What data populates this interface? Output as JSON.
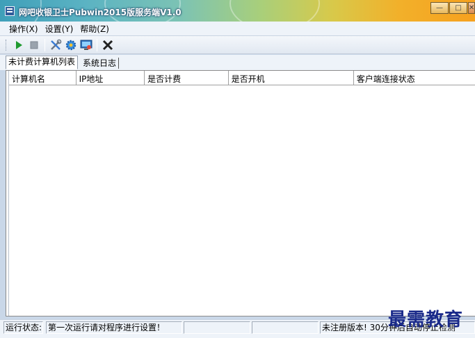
{
  "window": {
    "title": "网吧收银卫士Pubwin2015版服务端V1.0",
    "controls": {
      "minimize": "—",
      "maximize": "□",
      "close": "✕"
    }
  },
  "menu": {
    "items": [
      "操作(X)",
      "设置(Y)",
      "帮助(Z)"
    ]
  },
  "toolbar": {
    "buttons": [
      {
        "icon": "play-icon",
        "color": "#1f9a2f"
      },
      {
        "icon": "stop-icon",
        "color": "#9aa3ad"
      },
      {
        "icon": "tools-icon",
        "color": "#3a7bd5"
      },
      {
        "icon": "gear-icon",
        "color": "#3a8ee0"
      },
      {
        "icon": "monitor-icon",
        "color": "#2d6db8"
      },
      {
        "icon": "exit-icon",
        "color": "#222222"
      }
    ]
  },
  "tabs": [
    "未计费计算机列表",
    "系统日志"
  ],
  "table": {
    "columns": [
      "计算机名",
      "IP地址",
      "是否计费",
      "是否开机",
      "客户端连接状态"
    ],
    "rows": []
  },
  "statusbar": {
    "label": "运行状态:",
    "message": "第一次运行请对程序进行设置！",
    "registration": "未注册版本! 30分钟后自动停止检测"
  },
  "watermark": "最需教育"
}
